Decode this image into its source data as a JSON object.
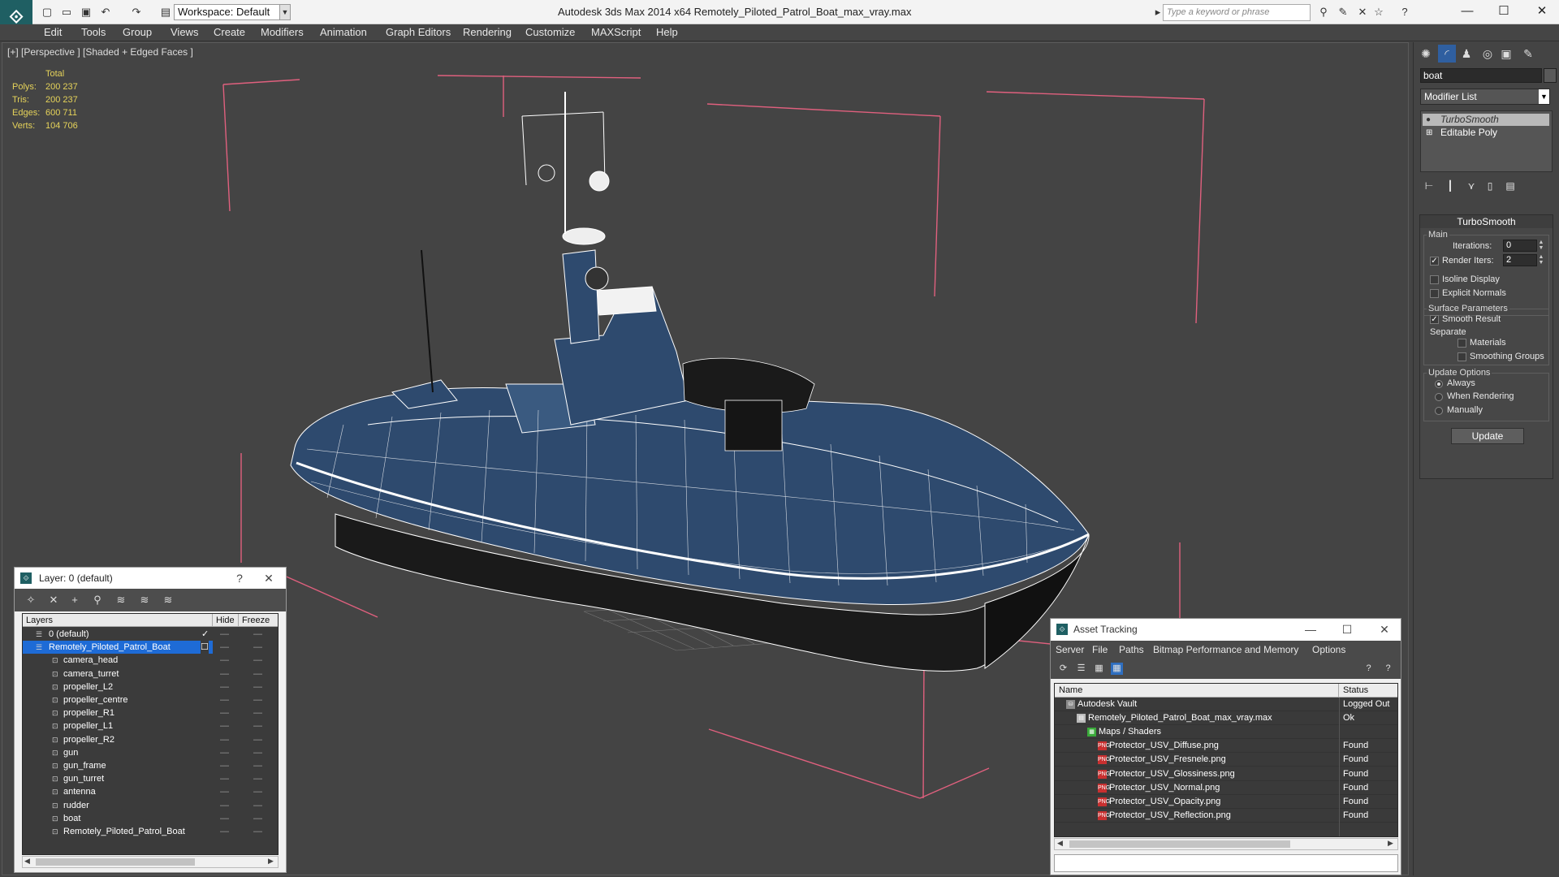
{
  "titlebar": {
    "app_title": "Autodesk 3ds Max 2014 x64      Remotely_Piloted_Patrol_Boat_max_vray.max",
    "workspace": "Workspace: Default",
    "search_placeholder": "Type a keyword or phrase"
  },
  "menu": [
    "Edit",
    "Tools",
    "Group",
    "Views",
    "Create",
    "Modifiers",
    "Animation",
    "Graph Editors",
    "Rendering",
    "Customize",
    "MAXScript",
    "Help"
  ],
  "viewport": {
    "label": "[+] [Perspective ] [Shaded + Edged Faces ]",
    "stats": {
      "header": "Total",
      "rows": [
        {
          "label": "Polys:",
          "value": "200 237"
        },
        {
          "label": "Tris:",
          "value": "200 237"
        },
        {
          "label": "Edges:",
          "value": "600 711"
        },
        {
          "label": "Verts:",
          "value": "104 706"
        }
      ]
    }
  },
  "command_panel": {
    "object_name": "boat",
    "modifier_list": "Modifier List",
    "stack": [
      "TurboSmooth",
      "Editable Poly"
    ],
    "rollout_title": "TurboSmooth",
    "main_group": "Main",
    "iterations_label": "Iterations:",
    "iterations_value": "0",
    "render_iters_label": "Render Iters:",
    "render_iters_value": "2",
    "render_iters_checked": true,
    "isoline_label": "Isoline Display",
    "explicit_normals_label": "Explicit Normals",
    "surface_group": "Surface Parameters",
    "smooth_result_label": "Smooth Result",
    "separate_label": "Separate",
    "materials_label": "Materials",
    "smoothing_groups_label": "Smoothing Groups",
    "update_group": "Update Options",
    "always_label": "Always",
    "when_rendering_label": "When Rendering",
    "manually_label": "Manually",
    "update_button": "Update"
  },
  "layer_dialog": {
    "title": "Layer: 0 (default)",
    "help": "?",
    "columns": [
      "Layers",
      "Hide",
      "Freeze"
    ],
    "rows": [
      {
        "name": "0 (default)",
        "level": 0
      },
      {
        "name": "Remotely_Piloted_Patrol_Boat",
        "level": 0,
        "selected": true
      },
      {
        "name": "camera_head",
        "level": 1
      },
      {
        "name": "camera_turret",
        "level": 1
      },
      {
        "name": "propeller_L2",
        "level": 1
      },
      {
        "name": "propeller_centre",
        "level": 1
      },
      {
        "name": "propeller_R1",
        "level": 1
      },
      {
        "name": "propeller_L1",
        "level": 1
      },
      {
        "name": "propeller_R2",
        "level": 1
      },
      {
        "name": "gun",
        "level": 1
      },
      {
        "name": "gun_frame",
        "level": 1
      },
      {
        "name": "gun_turret",
        "level": 1
      },
      {
        "name": "antenna",
        "level": 1
      },
      {
        "name": "rudder",
        "level": 1
      },
      {
        "name": "boat",
        "level": 1
      },
      {
        "name": "Remotely_Piloted_Patrol_Boat",
        "level": 1
      }
    ]
  },
  "asset_dialog": {
    "title": "Asset Tracking",
    "menu": [
      "Server",
      "File",
      "Paths",
      "Bitmap Performance and Memory",
      "Options"
    ],
    "columns": [
      "Name",
      "Status"
    ],
    "rows": [
      {
        "name": "Autodesk Vault",
        "status": "Logged Out",
        "level": 0
      },
      {
        "name": "Remotely_Piloted_Patrol_Boat_max_vray.max",
        "status": "Ok",
        "level": 1
      },
      {
        "name": "Maps / Shaders",
        "status": "",
        "level": 2
      },
      {
        "name": "Protector_USV_Diffuse.png",
        "status": "Found",
        "level": 3
      },
      {
        "name": "Protector_USV_Fresnele.png",
        "status": "Found",
        "level": 3
      },
      {
        "name": "Protector_USV_Glossiness.png",
        "status": "Found",
        "level": 3
      },
      {
        "name": "Protector_USV_Normal.png",
        "status": "Found",
        "level": 3
      },
      {
        "name": "Protector_USV_Opacity.png",
        "status": "Found",
        "level": 3
      },
      {
        "name": "Protector_USV_Reflection.png",
        "status": "Found",
        "level": 3
      }
    ]
  },
  "colors": {
    "viewport_bg": "#444444",
    "wire": "#ffffff",
    "hull_fill": "#2e4a6e",
    "bounding_box": "#e0607e",
    "stats_text": "#e6d35a",
    "selection": "#1e6bd6"
  }
}
